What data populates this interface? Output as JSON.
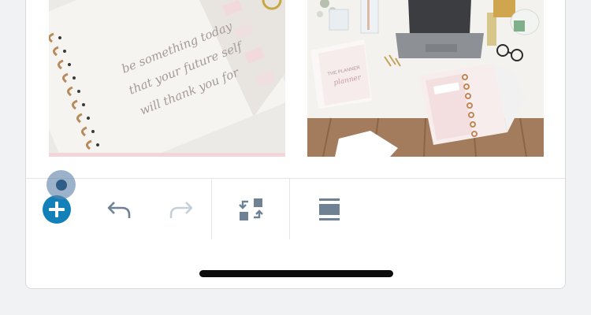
{
  "colors": {
    "accent": "#1480b8",
    "icon": "#6e8294",
    "icon_disabled": "#c6d0d9",
    "page_background": "#f1f2f3",
    "touch_indicator": "#5d82aa"
  },
  "gallery": {
    "images": [
      {
        "name": "planner-notebook",
        "handwriting": [
          "be something today",
          "that your future self",
          "will thank you for"
        ]
      },
      {
        "name": "desk-flatlay",
        "cover_text": [
          "THE PLANNER",
          "planner"
        ]
      }
    ]
  },
  "toolbar": {
    "buttons": [
      {
        "name": "add-block",
        "icon": "plus-circle-icon",
        "enabled": true
      },
      {
        "name": "undo",
        "icon": "undo-icon",
        "enabled": true
      },
      {
        "name": "redo",
        "icon": "redo-icon",
        "enabled": false
      },
      {
        "name": "transform-block",
        "icon": "transform-icon",
        "enabled": true
      },
      {
        "name": "block-settings",
        "icon": "block-settings-icon",
        "enabled": true
      }
    ]
  }
}
